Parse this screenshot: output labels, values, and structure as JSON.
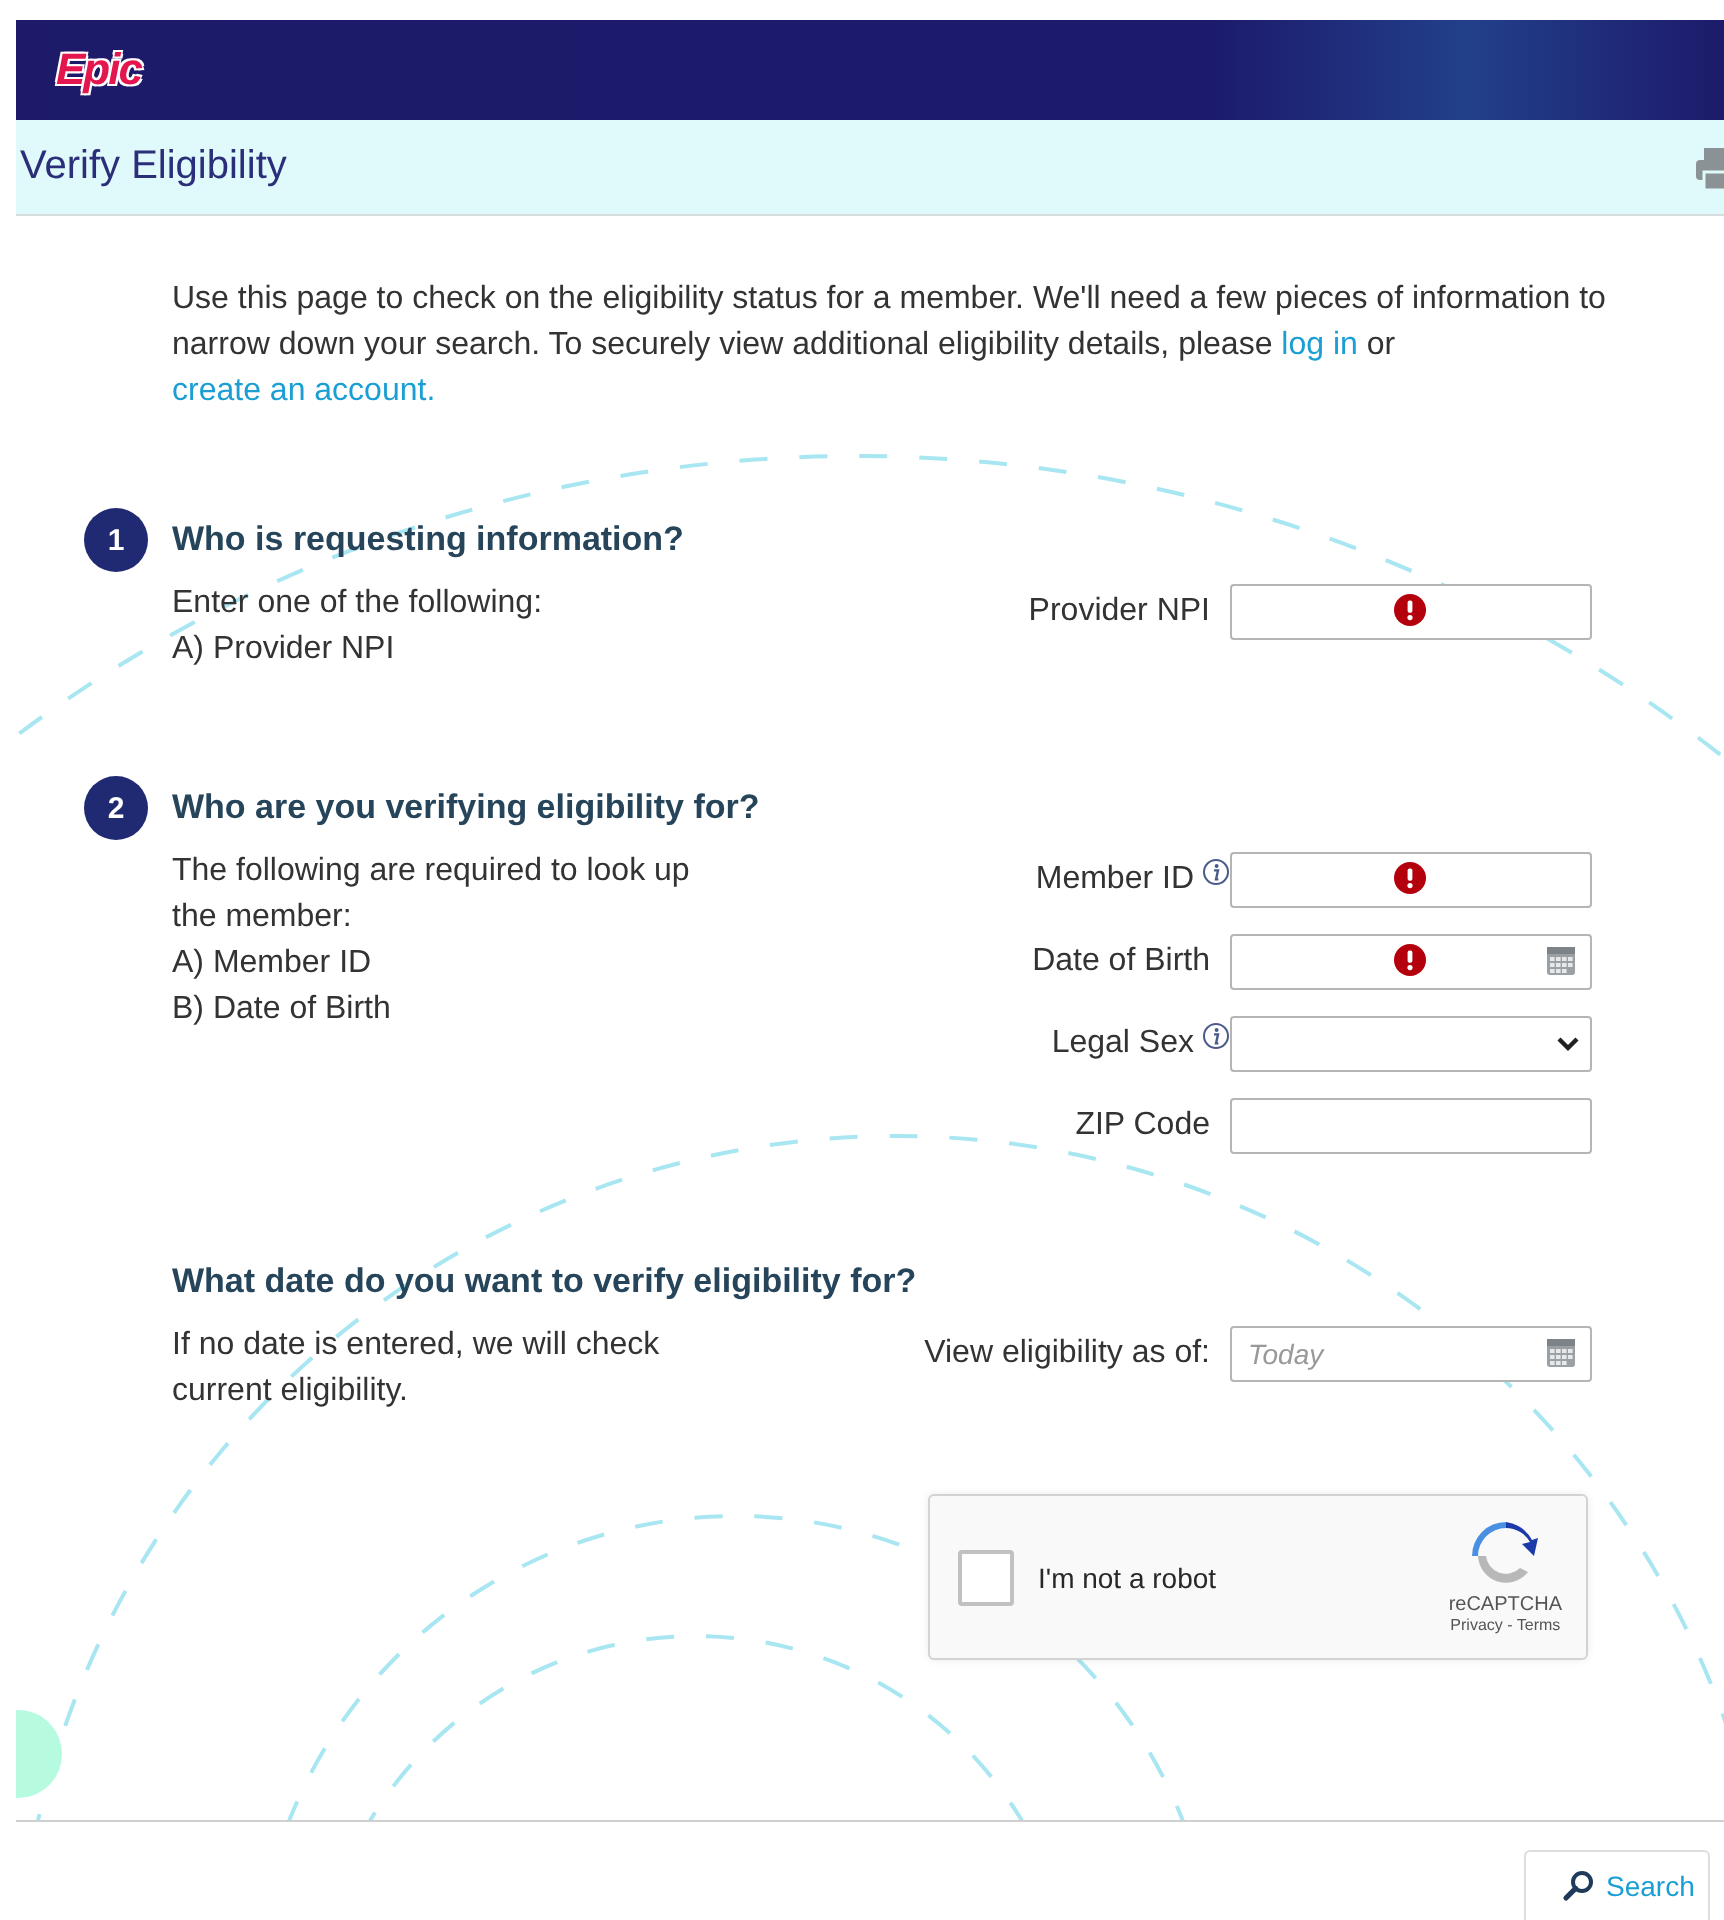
{
  "header": {
    "logo": "Epic"
  },
  "title_bar": {
    "title": "Verify Eligibility"
  },
  "intro": [
    {
      "kind": "text",
      "text": "Use this page to check on the eligibility status for a member. We'll need a few pieces of information to narrow down your search. To securely view additional eligibility details, please "
    },
    {
      "kind": "link",
      "text": "log in"
    },
    {
      "kind": "text",
      "text": " or "
    },
    {
      "kind": "link",
      "text": "create an account."
    }
  ],
  "sections": [
    {
      "number": "1",
      "heading": "Who is requesting information?",
      "description": [
        "Enter one of the following:",
        "A) Provider NPI"
      ],
      "fields": [
        {
          "label": "Provider NPI",
          "kind": "text",
          "error": true,
          "info": false
        }
      ]
    },
    {
      "number": "2",
      "heading": "Who are you verifying eligibility for?",
      "description": [
        "The following are required to look up the member:",
        "A) Member ID",
        "B) Date of Birth"
      ],
      "fields": [
        {
          "label": "Member ID",
          "kind": "text",
          "error": true,
          "info": true
        },
        {
          "label": "Date of Birth",
          "kind": "date",
          "error": true,
          "info": false
        },
        {
          "label": "Legal Sex",
          "kind": "select",
          "error": false,
          "info": true
        },
        {
          "label": "ZIP Code",
          "kind": "text",
          "error": false,
          "info": false
        }
      ]
    },
    {
      "heading": "What date do you want to verify eligibility for?",
      "description": [
        "If no date is entered, we will check current eligibility."
      ],
      "fields": [
        {
          "label": "View eligibility as of:",
          "kind": "date",
          "error": false,
          "info": false,
          "placeholder": "Today"
        }
      ]
    }
  ],
  "captcha": {
    "label": "I'm not a robot",
    "checked": false,
    "brand": "reCAPTCHA",
    "links": "Privacy - Terms"
  },
  "search_button": "Search"
}
